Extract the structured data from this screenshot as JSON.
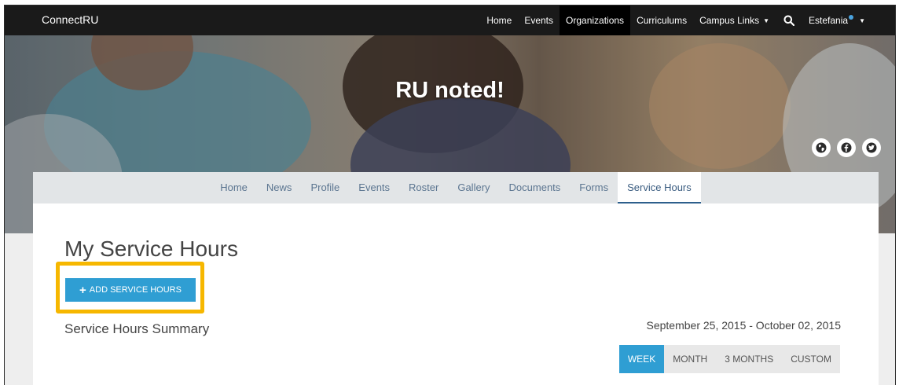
{
  "topbar": {
    "brand": "ConnectRU",
    "nav": [
      {
        "label": "Home",
        "active": false
      },
      {
        "label": "Events",
        "active": false
      },
      {
        "label": "Organizations",
        "active": true
      },
      {
        "label": "Curriculums",
        "active": false
      },
      {
        "label": "Campus Links",
        "active": false,
        "dropdown": true
      }
    ],
    "search_icon": "search-icon",
    "user": "Estefania"
  },
  "hero": {
    "title": "RU noted!",
    "social_icons": [
      "globe-icon",
      "facebook-icon",
      "twitter-icon"
    ]
  },
  "subnav": [
    {
      "label": "Home"
    },
    {
      "label": "News"
    },
    {
      "label": "Profile"
    },
    {
      "label": "Events"
    },
    {
      "label": "Roster"
    },
    {
      "label": "Gallery"
    },
    {
      "label": "Documents"
    },
    {
      "label": "Forms"
    },
    {
      "label": "Service Hours",
      "active": true
    }
  ],
  "main": {
    "title": "My Service Hours",
    "add_button": "ADD SERVICE HOURS",
    "summary_title": "Service Hours Summary",
    "date_range": "September 25, 2015 - October 02, 2015",
    "range_tabs": [
      {
        "label": "WEEK",
        "active": true
      },
      {
        "label": "MONTH"
      },
      {
        "label": "3 MONTHS"
      },
      {
        "label": "CUSTOM"
      }
    ]
  },
  "colors": {
    "topbar": "#1a1a1a",
    "accent": "#2f9ed3",
    "highlight": "#f6b700",
    "subnav_text": "#5b7590"
  }
}
